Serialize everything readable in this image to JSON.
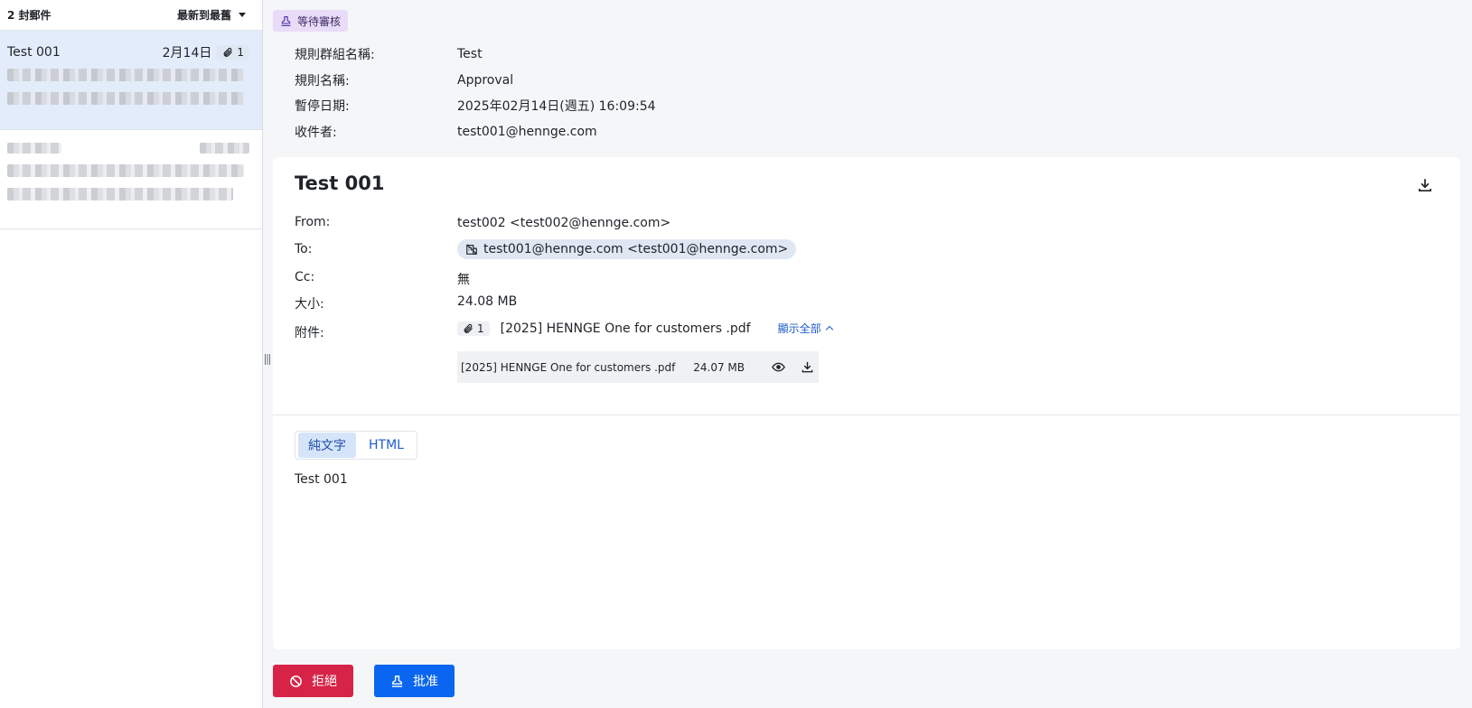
{
  "list": {
    "count_label": "2 封郵件",
    "sort_label": "最新到最舊",
    "items": [
      {
        "subject": "Test 001",
        "date": "2月14日",
        "attachments": "1"
      }
    ]
  },
  "status": {
    "label": "等待審核",
    "icon": "stamp-icon",
    "color": "#e9dcf9"
  },
  "meta": {
    "rule_group_key": "規則群組名稱:",
    "rule_group_value": "Test",
    "rule_name_key": "規則名稱:",
    "rule_name_value": "Approval",
    "hold_date_key": "暫停日期:",
    "hold_date_value": "2025年02月14日(週五) 16:09:54",
    "recipient_key": "收件者:",
    "recipient_value": "test001@hennge.com"
  },
  "message": {
    "title": "Test 001",
    "from_key": "From:",
    "from_value": "test002 <test002@hennge.com>",
    "to_key": "To:",
    "to_value": "test001@hennge.com <test001@hennge.com>",
    "cc_key": "Cc:",
    "cc_value": "無",
    "size_key": "大小:",
    "size_value": "24.08 MB",
    "attach_key": "附件:",
    "attach_count": "1",
    "attach_name": "[2025] HENNGE One for customers .pdf",
    "show_all": "顯示全部",
    "file": {
      "name": "[2025] HENNGE One for customers .pdf",
      "size": "24.07 MB"
    },
    "tabs": [
      "純文字",
      "HTML"
    ],
    "active_tab": "純文字",
    "body": "Test 001"
  },
  "actions": {
    "reject": "拒絕",
    "approve": "批准"
  },
  "colors": {
    "reject": "#d72347",
    "approve": "#0a66f0",
    "selected_row": "#e3ecfb",
    "link": "#1d5cc9"
  }
}
